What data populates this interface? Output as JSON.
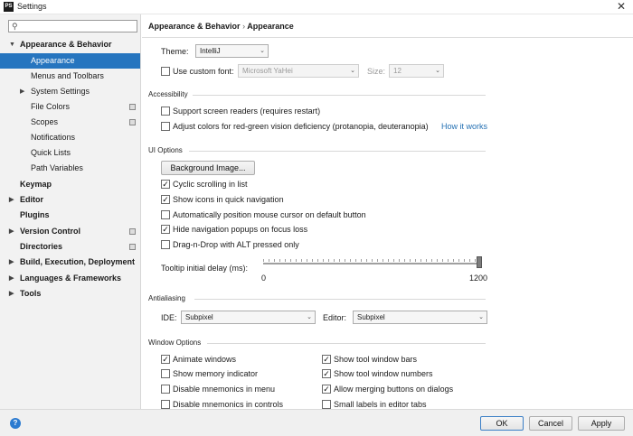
{
  "window": {
    "app_icon": "PS",
    "title": "Settings",
    "close": "✕"
  },
  "sidebar": {
    "search_placeholder": "",
    "items": [
      {
        "label": "Appearance & Behavior",
        "expanded": true
      },
      {
        "label": "Appearance"
      },
      {
        "label": "Menus and Toolbars"
      },
      {
        "label": "System Settings"
      },
      {
        "label": "File Colors"
      },
      {
        "label": "Scopes"
      },
      {
        "label": "Notifications"
      },
      {
        "label": "Quick Lists"
      },
      {
        "label": "Path Variables"
      },
      {
        "label": "Keymap"
      },
      {
        "label": "Editor"
      },
      {
        "label": "Plugins"
      },
      {
        "label": "Version Control"
      },
      {
        "label": "Directories"
      },
      {
        "label": "Build, Execution, Deployment"
      },
      {
        "label": "Languages & Frameworks"
      },
      {
        "label": "Tools"
      }
    ]
  },
  "breadcrumb": {
    "parent": "Appearance & Behavior",
    "separator": "›",
    "current": "Appearance"
  },
  "theme": {
    "label": "Theme:",
    "value": "IntelliJ"
  },
  "custom_font": {
    "checked": false,
    "label": "Use custom font:",
    "font": "Microsoft YaHei",
    "size_label": "Size:",
    "size": "12"
  },
  "accessibility": {
    "title": "Accessibility",
    "screen_readers": {
      "checked": false,
      "label": "Support screen readers (requires restart)"
    },
    "red_green": {
      "checked": false,
      "label": "Adjust colors for red-green vision deficiency (protanopia, deuteranopia)",
      "link": "How it works"
    }
  },
  "ui_options": {
    "title": "UI Options",
    "background_button": "Background Image...",
    "cyclic": {
      "checked": true,
      "label": "Cyclic scrolling in list"
    },
    "icons_quick_nav": {
      "checked": true,
      "label": "Show icons in quick navigation"
    },
    "auto_mouse": {
      "checked": false,
      "label": "Automatically position mouse cursor on default button"
    },
    "hide_popups": {
      "checked": true,
      "label": "Hide navigation popups on focus loss"
    },
    "drag_drop_alt": {
      "checked": false,
      "label": "Drag-n-Drop with ALT pressed only"
    },
    "tooltip_delay": {
      "label": "Tooltip initial delay (ms):",
      "min": "0",
      "max": "1200",
      "value": 1200
    }
  },
  "antialiasing": {
    "title": "Antialiasing",
    "ide_label": "IDE:",
    "ide_value": "Subpixel",
    "editor_label": "Editor:",
    "editor_value": "Subpixel"
  },
  "window_options": {
    "title": "Window Options",
    "animate_windows": {
      "checked": true,
      "label": "Animate windows"
    },
    "memory_indicator": {
      "checked": false,
      "label": "Show memory indicator"
    },
    "disable_mnemonics_menu": {
      "checked": false,
      "label": "Disable mnemonics in menu"
    },
    "disable_mnemonics_controls": {
      "checked": false,
      "label": "Disable mnemonics in controls"
    },
    "tool_window_bars": {
      "checked": true,
      "label": "Show tool window bars"
    },
    "tool_window_numbers": {
      "checked": true,
      "label": "Show tool window numbers"
    },
    "merge_buttons": {
      "checked": true,
      "label": "Allow merging buttons on dialogs"
    },
    "small_labels": {
      "checked": false,
      "label": "Small labels in editor tabs"
    }
  },
  "footer": {
    "help_icon": "?",
    "ok": "OK",
    "cancel": "Cancel",
    "apply": "Apply"
  },
  "icons": {
    "check": "✓",
    "collapsed": "▶",
    "expanded": "▼",
    "dropdown": "⌄",
    "search": "⚲"
  }
}
